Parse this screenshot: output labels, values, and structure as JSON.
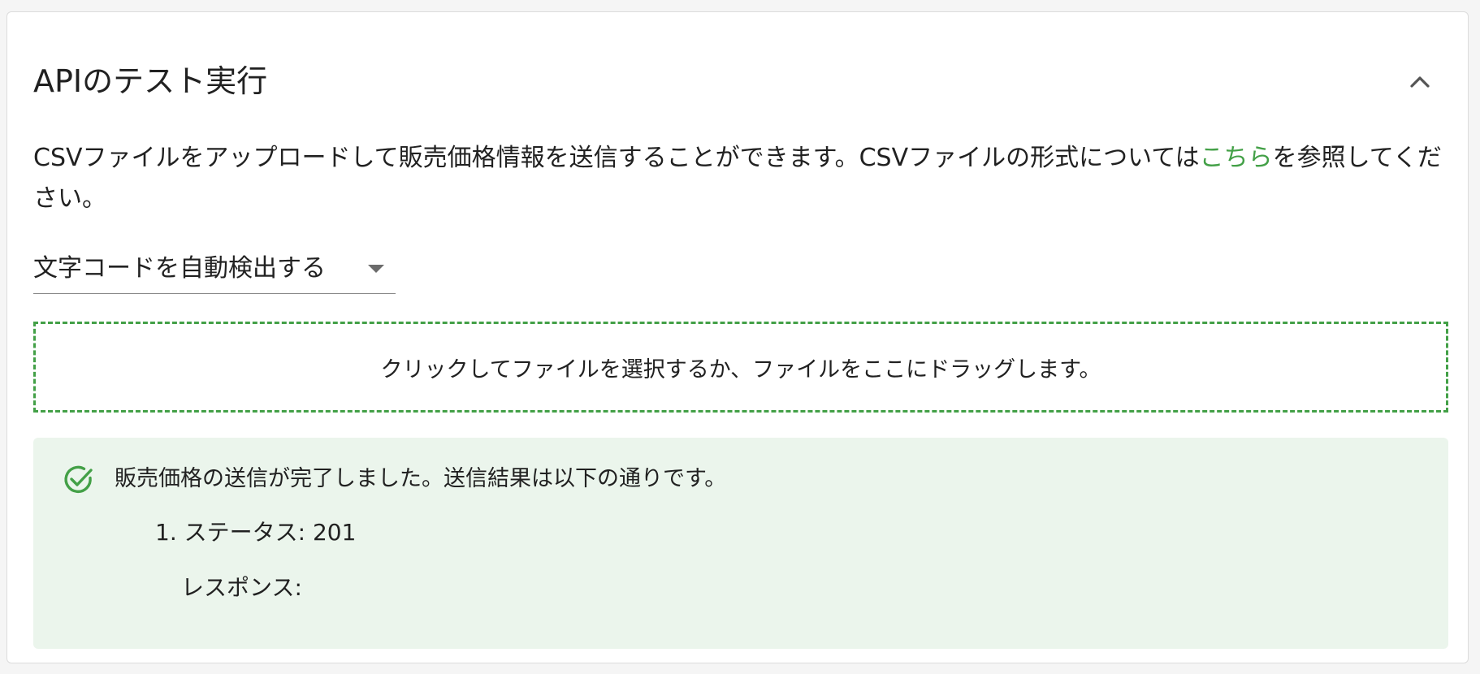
{
  "header": {
    "title": "APIのテスト実行",
    "collapse_icon": "chevron-up-icon"
  },
  "description": {
    "text_before_link": "CSVファイルをアップロードして販売価格情報を送信することができます。CSVファイルの形式については",
    "link_text": "こちら",
    "text_after_link": "を参照してください。"
  },
  "encoding": {
    "selected": "文字コードを自動検出する",
    "arrow_icon": "caret-down-icon"
  },
  "dropzone": {
    "text": "クリックしてファイルを選択するか、ファイルをここにドラッグします。"
  },
  "result": {
    "icon": "check-circle-icon",
    "message": "販売価格の送信が完了しました。送信結果は以下の通りです。",
    "items": [
      {
        "number": "1.",
        "status_label": "ステータス:",
        "status_value": "201",
        "response_label": "レスポンス:",
        "response_value": ""
      }
    ]
  },
  "colors": {
    "accent": "#43a047",
    "success_bg": "#ebf5ec",
    "text": "#212121"
  }
}
